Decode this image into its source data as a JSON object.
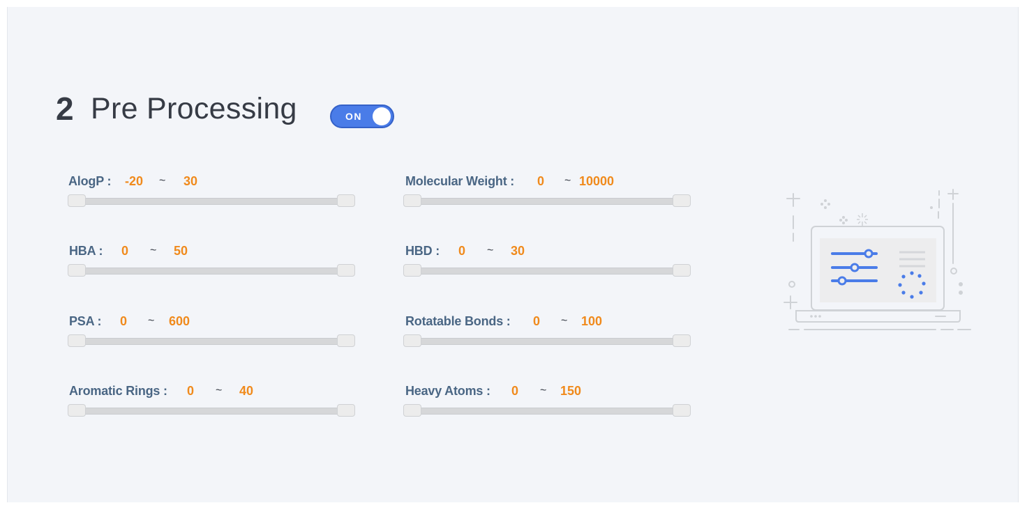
{
  "section": {
    "number": "2",
    "title": "Pre Processing"
  },
  "toggle": {
    "label": "ON",
    "state": true
  },
  "colors": {
    "accent": "#4a7ce8",
    "value": "#f08a1c",
    "label": "#4a6684",
    "background": "#f3f5f9"
  },
  "filters": [
    {
      "label": "AlogP :",
      "min": "-20",
      "max": "30",
      "tilde": "~",
      "low_fraction": 0,
      "high_fraction": 1
    },
    {
      "label": "Molecular Weight :",
      "min": "0",
      "max": "10000",
      "tilde": "~",
      "low_fraction": 0,
      "high_fraction": 1
    },
    {
      "label": "HBA :",
      "min": "0",
      "max": "50",
      "tilde": "~",
      "low_fraction": 0,
      "high_fraction": 1
    },
    {
      "label": "HBD :",
      "min": "0",
      "max": "30",
      "tilde": "~",
      "low_fraction": 0,
      "high_fraction": 1
    },
    {
      "label": "PSA :",
      "min": "0",
      "max": "600",
      "tilde": "~",
      "low_fraction": 0,
      "high_fraction": 1
    },
    {
      "label": "Rotatable Bonds :",
      "min": "0",
      "max": "100",
      "tilde": "~",
      "low_fraction": 0,
      "high_fraction": 1
    },
    {
      "label": "Aromatic Rings :",
      "min": "0",
      "max": "40",
      "tilde": "~",
      "low_fraction": 0,
      "high_fraction": 1
    },
    {
      "label": "Heavy Atoms :",
      "min": "0",
      "max": "150",
      "tilde": "~",
      "low_fraction": 0,
      "high_fraction": 1
    }
  ],
  "illustration": {
    "icon": "laptop-settings-illustration"
  }
}
